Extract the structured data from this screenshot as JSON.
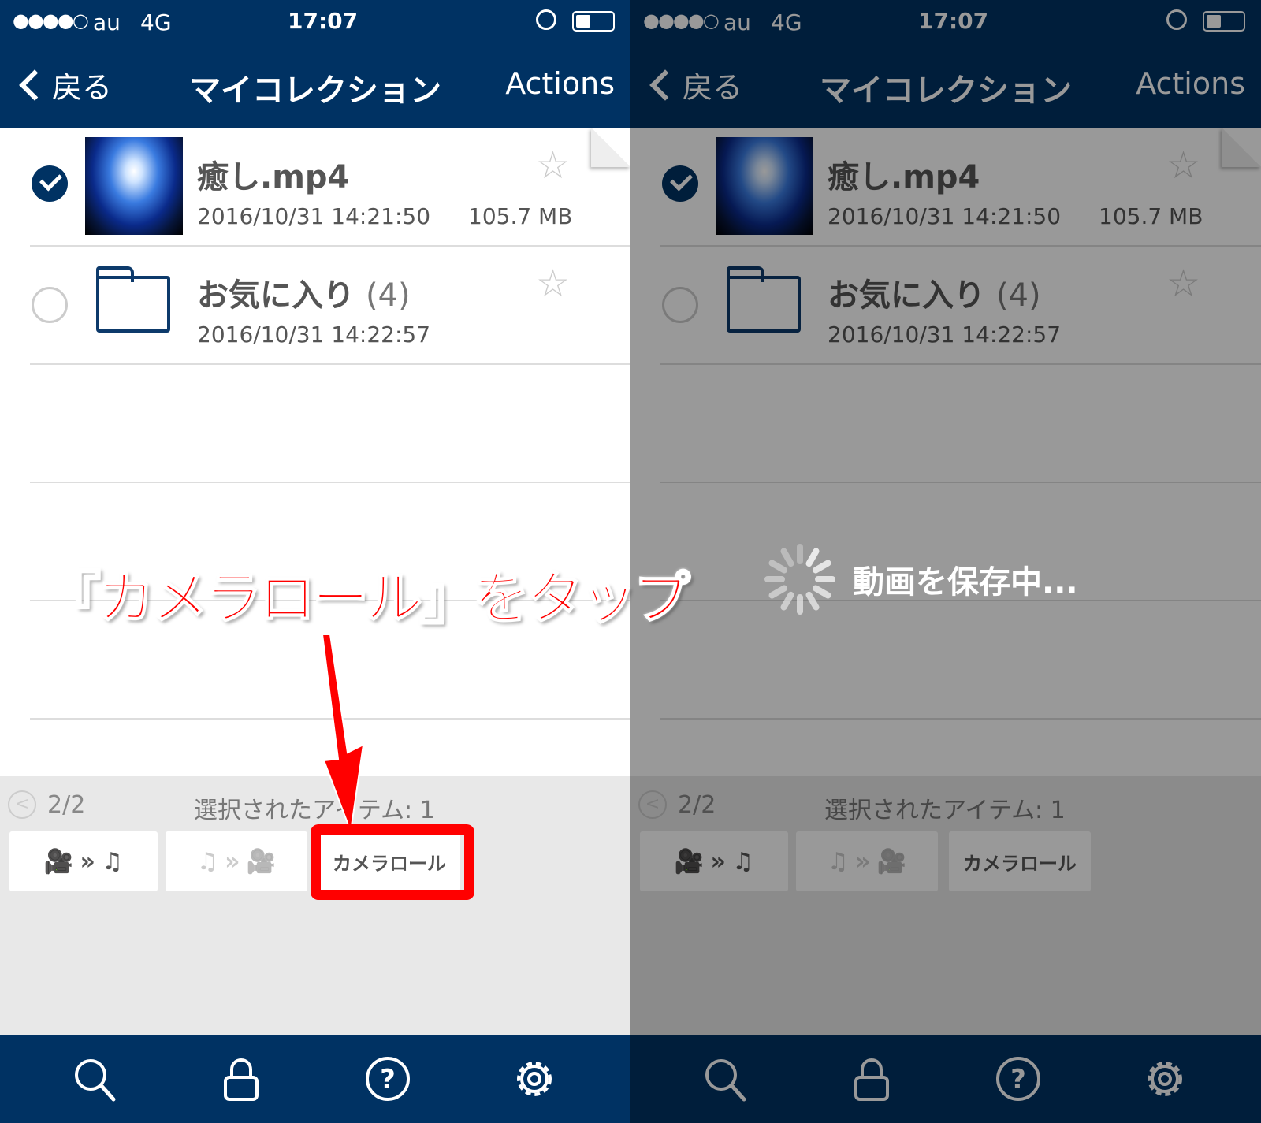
{
  "status": {
    "signal": "●●●●○",
    "carrier": "au",
    "network": "4G",
    "time": "17:07"
  },
  "nav": {
    "back": "戻る",
    "title": "マイコレクション",
    "actions": "Actions"
  },
  "items": [
    {
      "name": "癒し.mp4",
      "date": "2016/10/31 14:21:50",
      "size": "105.7 MB",
      "selected": true,
      "type": "video"
    },
    {
      "name": "お気に入り",
      "count": "(4)",
      "date": "2016/10/31 14:22:57",
      "selected": false,
      "type": "folder"
    }
  ],
  "toolbar": {
    "page": "2/2",
    "selected": "選択されたアイテム: 1",
    "camera_roll": "カメラロール",
    "video_to_audio": "video-to-music",
    "audio_to_video": "music-to-video"
  },
  "tabs": [
    "search-icon",
    "lock-icon",
    "help-icon",
    "gear-icon"
  ],
  "saving": {
    "text": "動画を保存中..."
  },
  "annotation": {
    "text": "『カメラロール』をタップ",
    "color": "#ff0000"
  },
  "colors": {
    "navy": "#003263",
    "toolbar": "#e8e8e8"
  }
}
